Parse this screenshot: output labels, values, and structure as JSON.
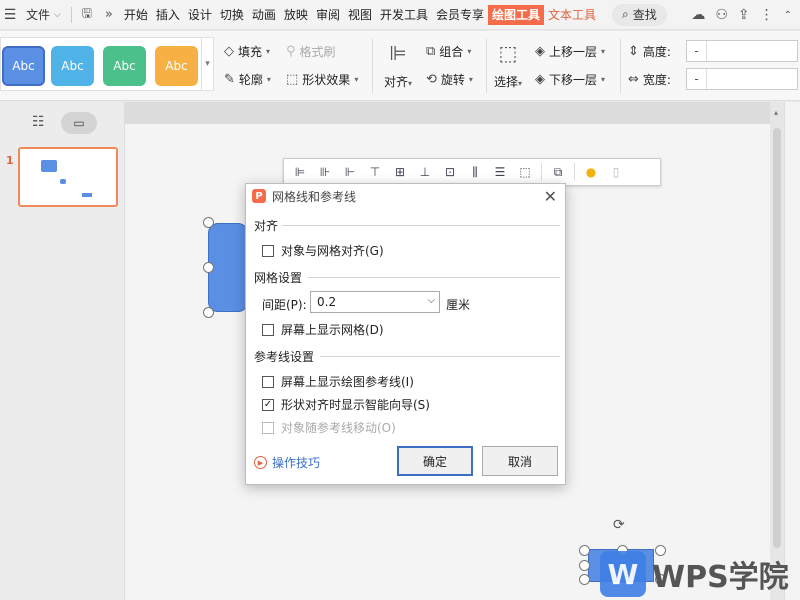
{
  "menubar": {
    "file_label": "文件",
    "tabs": [
      "开始",
      "插入",
      "设计",
      "切换",
      "动画",
      "放映",
      "审阅",
      "视图",
      "开发工具",
      "会员专享"
    ],
    "active_tab": "绘图工具",
    "accent_tab": "文本工具",
    "search_label": "查找"
  },
  "ribbon": {
    "style_samples": [
      {
        "label": "Abc",
        "color": "#5b8fe4"
      },
      {
        "label": "Abc",
        "color": "#4fb3e8"
      },
      {
        "label": "Abc",
        "color": "#4cc08a"
      },
      {
        "label": "Abc",
        "color": "#f7b044"
      }
    ],
    "fill_label": "填充",
    "format_brush_label": "格式刷",
    "outline_label": "轮廓",
    "shape_effect_label": "形状效果",
    "align_label": "对齐",
    "group_label": "组合",
    "rotate_label": "旋转",
    "select_label": "选择",
    "bring_forward_label": "上移一层",
    "send_backward_label": "下移一层",
    "height_label": "高度:",
    "width_label": "宽度:",
    "minus": "-",
    "plus": "+"
  },
  "slides": {
    "current_number": "1"
  },
  "dialog": {
    "title": "网格线和参考线",
    "logo": "P",
    "close": "✕",
    "section_align": "对齐",
    "snap_to_grid": "对象与网格对齐(G)",
    "snap_to_grid_checked": false,
    "section_grid": "网格设置",
    "spacing_label": "间距(P):",
    "spacing_value": "0.2",
    "spacing_unit": "厘米",
    "show_grid": "屏幕上显示网格(D)",
    "show_grid_checked": false,
    "section_guides": "参考线设置",
    "show_guides": "屏幕上显示绘图参考线(I)",
    "show_guides_checked": false,
    "smart_guides": "形状对齐时显示智能向导(S)",
    "smart_guides_checked": true,
    "move_with_guides": "对象随参考线移动(O)",
    "move_with_guides_checked": false,
    "tips_label": "操作技巧",
    "ok_label": "确定",
    "cancel_label": "取消"
  },
  "watermark": {
    "logo": "W",
    "text": "WPS学院"
  }
}
